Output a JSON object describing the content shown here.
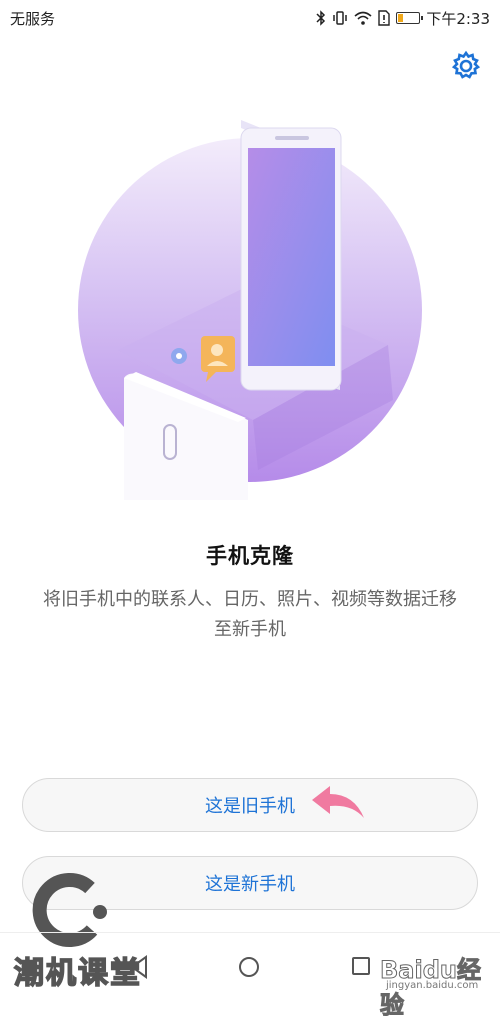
{
  "status_bar": {
    "carrier": "无服务",
    "time": "下午2:33",
    "battery_level_fraction": 0.25
  },
  "header": {
    "settings_icon": "gear-icon",
    "accent_color": "#1e73d6"
  },
  "main": {
    "title": "手机克隆",
    "description": "将旧手机中的联系人、日历、照片、视频等数据迁移至新手机"
  },
  "actions": {
    "old_phone_label": "这是旧手机",
    "new_phone_label": "这是新手机"
  },
  "nav_bar": {
    "icons": [
      "back-icon",
      "home-icon",
      "recent-apps-icon"
    ]
  },
  "watermarks": {
    "left_text": "潮机课堂",
    "right_text": "Baidu经验",
    "right_sub": "jingyan.baidu.com"
  }
}
